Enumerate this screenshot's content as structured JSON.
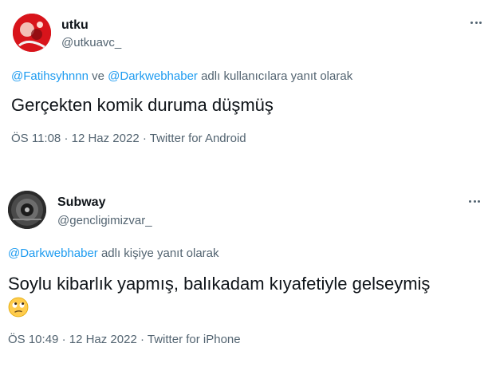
{
  "tweets": [
    {
      "display_name": "utku",
      "handle": "@utkuavc_",
      "reply_mentions": [
        "@Fatihsyhnnn",
        "@Darkwebhaber"
      ],
      "reply_joiner": "ve",
      "reply_suffix": "adlı kullanıcılara yanıt olarak",
      "text": "Gerçekten komik duruma düşmüş",
      "time": "ÖS 11:08",
      "date": "12 Haz 2022",
      "source": "Twitter for Android",
      "separator": "·",
      "avatar_icon": "profile-photo-red",
      "more_icon": "more-options-icon"
    },
    {
      "display_name": "Subway",
      "handle": "@gencligimizvar_",
      "reply_mentions": [
        "@Darkwebhaber"
      ],
      "reply_suffix": "adlı kişiye yanıt olarak",
      "text": "Soylu kibarlık yapmış, balıkadam kıyafetiyle gelseymiş",
      "emoji": "face-with-rolling-eyes",
      "time": "ÖS 10:49",
      "date": "12 Haz 2022",
      "source": "Twitter for iPhone",
      "separator": "·",
      "avatar_icon": "profile-photo-tunnel",
      "more_icon": "more-options-icon"
    }
  ],
  "colors": {
    "link": "#1d9bf0",
    "secondary_text": "#536471",
    "primary_text": "#0f1419"
  }
}
